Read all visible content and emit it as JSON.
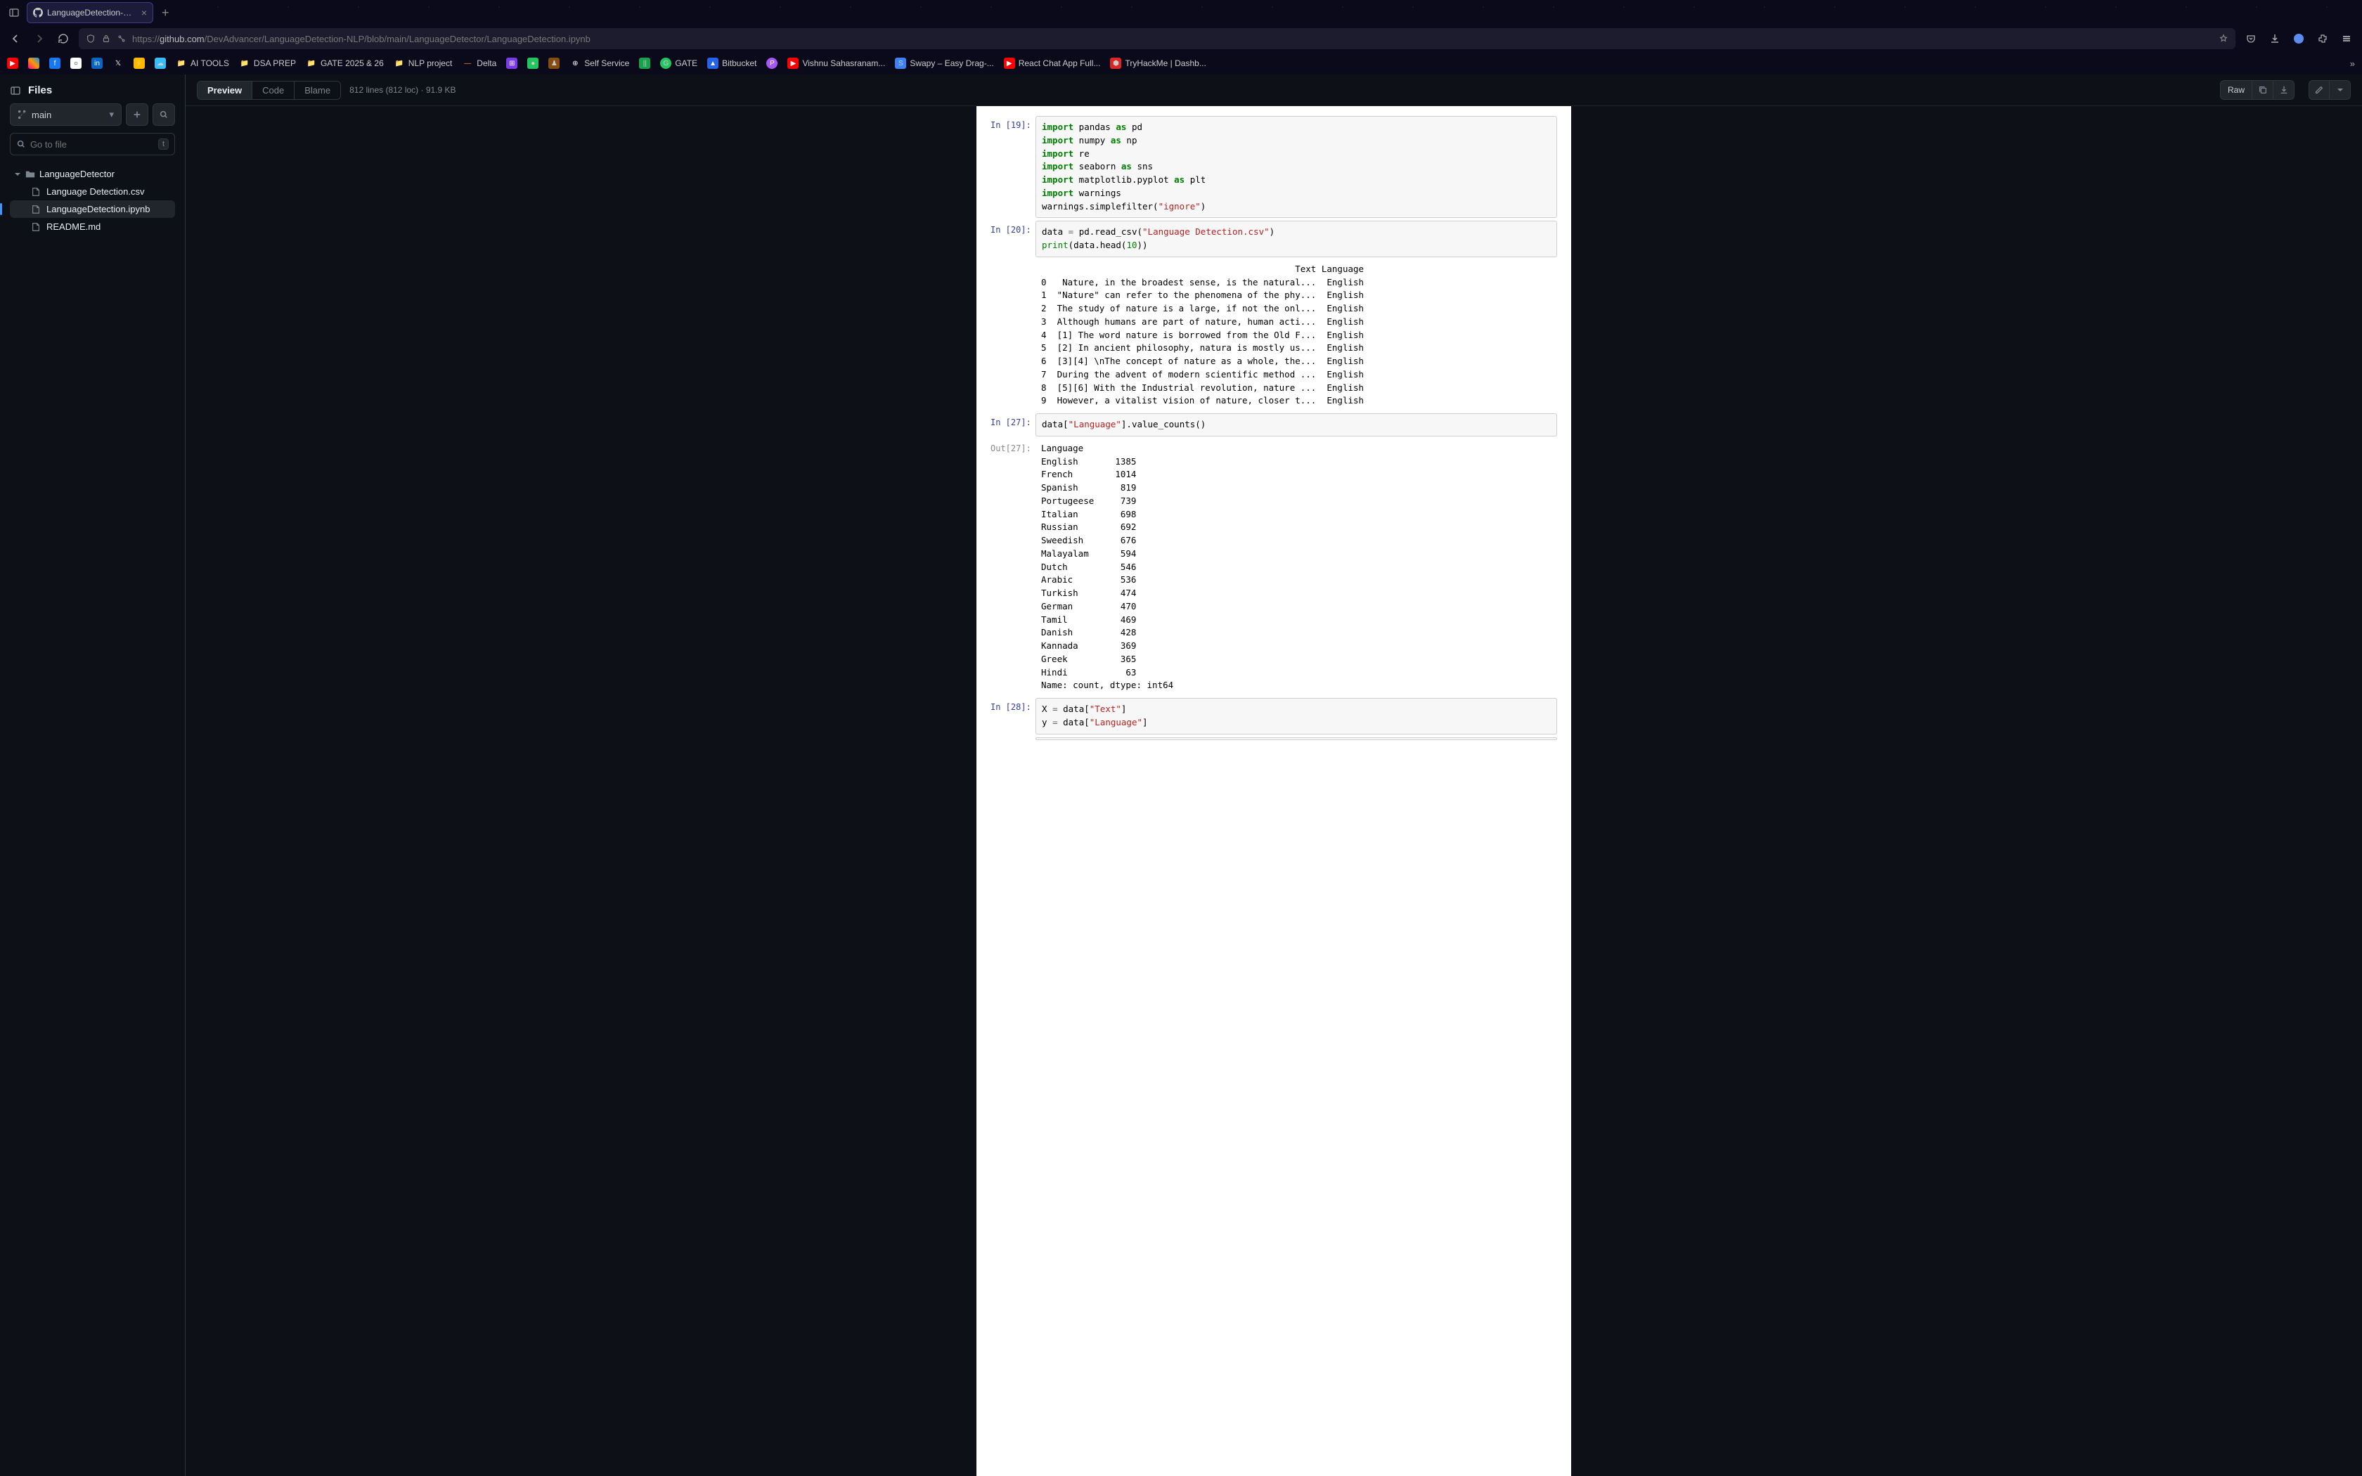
{
  "browser": {
    "tab_title": "LanguageDetection-NLP/Langu…",
    "url_prefix": "https://",
    "url_domain": "github.com",
    "url_path": "/DevAdvancer/LanguageDetection-NLP/blob/main/LanguageDetector/LanguageDetection.ipynb",
    "bookmarks": [
      "AI TOOLS",
      "DSA PREP",
      "GATE 2025 & 26",
      "NLP project",
      "Delta",
      "Self Service",
      "GATE",
      "Bitbucket",
      "Vishnu Sahasranam...",
      "Swapy – Easy Drag-...",
      "React Chat App Full...",
      "TryHackMe | Dashb..."
    ]
  },
  "sidebar": {
    "header": "Files",
    "branch": "main",
    "search_placeholder": "Go to file",
    "search_kbd": "t",
    "folder": "LanguageDetector",
    "files": [
      "Language Detection.csv",
      "LanguageDetection.ipynb",
      "README.md"
    ]
  },
  "toolbar": {
    "tabs": [
      "Preview",
      "Code",
      "Blame"
    ],
    "stats": "812 lines (812 loc) · 91.9 KB",
    "raw": "Raw"
  },
  "cells": {
    "in19_lines": [
      {
        "t": "kw",
        "v": "import"
      },
      {
        "t": "",
        "v": " pandas "
      },
      {
        "t": "kw",
        "v": "as"
      },
      {
        "t": "",
        "v": " pd"
      }
    ],
    "in19": "import pandas as pd\nimport numpy as np\nimport re\nimport seaborn as sns\nimport matplotlib.pyplot as plt\nimport warnings\nwarnings.simplefilter(\"ignore\")",
    "in20": "data = pd.read_csv(\"Language Detection.csv\")\nprint(data.head(10))",
    "out20": "                                                Text Language\n0   Nature, in the broadest sense, is the natural...  English\n1  \"Nature\" can refer to the phenomena of the phy...  English\n2  The study of nature is a large, if not the onl...  English\n3  Although humans are part of nature, human acti...  English\n4  [1] The word nature is borrowed from the Old F...  English\n5  [2] In ancient philosophy, natura is mostly us...  English\n6  [3][4] \\nThe concept of nature as a whole, the...  English\n7  During the advent of modern scientific method ...  English\n8  [5][6] With the Industrial revolution, nature ...  English\n9  However, a vitalist vision of nature, closer t...  English",
    "in27": "data[\"Language\"].value_counts()",
    "out27": "Language\nEnglish       1385\nFrench        1014\nSpanish        819\nPortugeese     739\nItalian        698\nRussian        692\nSweedish       676\nMalayalam      594\nDutch          546\nArabic         536\nTurkish        474\nGerman         470\nTamil          469\nDanish         428\nKannada        369\nGreek          365\nHindi           63\nName: count, dtype: int64",
    "in28": "X = data[\"Text\"]\ny = data[\"Language\"]",
    "p19": "In [19]:",
    "p20": "In [20]:",
    "p27": "In [27]:",
    "po27": "Out[27]:",
    "p28": "In [28]:"
  }
}
